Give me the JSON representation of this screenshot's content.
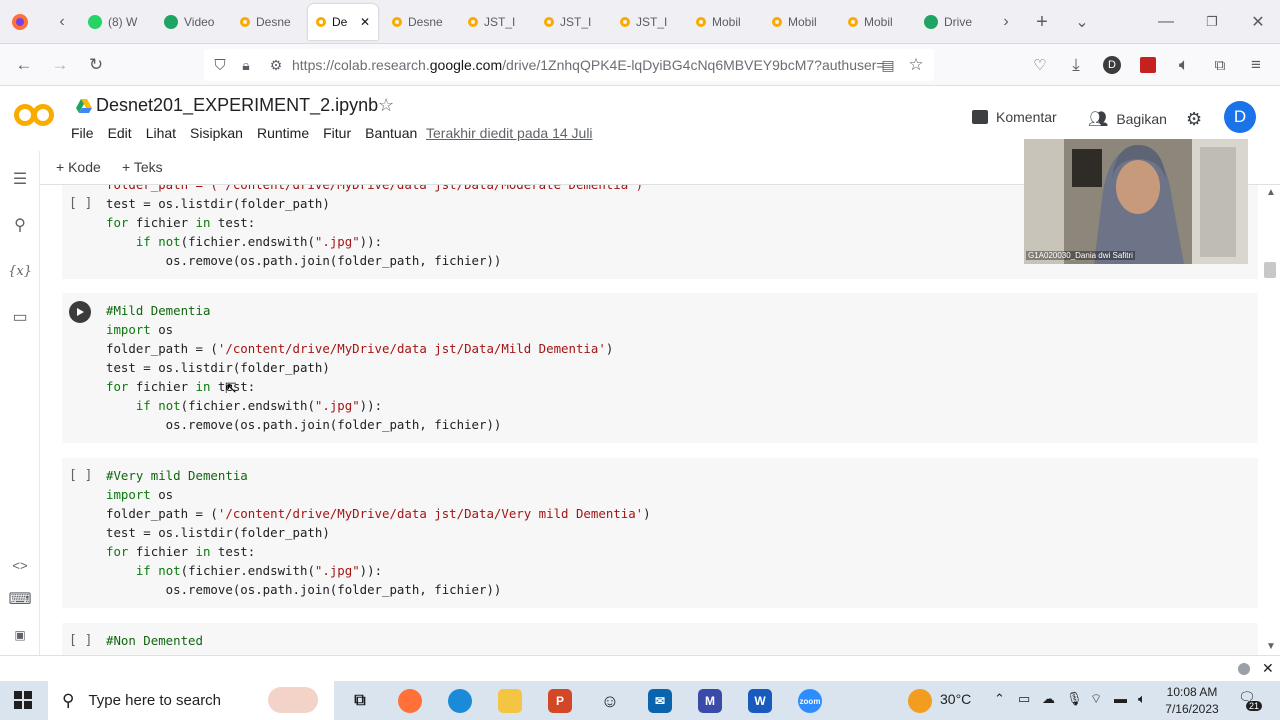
{
  "browser": {
    "tabs": [
      {
        "label": "(8) W",
        "favicon": "whatsapp-icon",
        "color": "#25d366"
      },
      {
        "label": "Video",
        "favicon": "drive-icon",
        "color": "#1fa463"
      },
      {
        "label": "Desne",
        "favicon": "colab-icon",
        "color": "#f9ab00"
      },
      {
        "label": "De",
        "favicon": "colab-icon",
        "color": "#f9ab00",
        "active": true
      },
      {
        "label": "Desne",
        "favicon": "colab-icon",
        "color": "#f9ab00"
      },
      {
        "label": "JST_I",
        "favicon": "colab-icon",
        "color": "#f9ab00"
      },
      {
        "label": "JST_I",
        "favicon": "colab-icon",
        "color": "#f9ab00"
      },
      {
        "label": "JST_I",
        "favicon": "colab-icon",
        "color": "#f9ab00"
      },
      {
        "label": "Mobil",
        "favicon": "colab-icon",
        "color": "#f9ab00"
      },
      {
        "label": "Mobil",
        "favicon": "colab-icon",
        "color": "#f9ab00"
      },
      {
        "label": "Mobil",
        "favicon": "colab-icon",
        "color": "#f9ab00"
      },
      {
        "label": "Drive",
        "favicon": "drive-icon",
        "color": "#1fa463"
      }
    ],
    "url_prefix": "https://colab.research.",
    "url_domain": "google.com",
    "url_rest": "/drive/1ZnhqQPK4E-lqDyiBG4cNq6MBVEY9bcM7?authuser="
  },
  "colab": {
    "notebook_title": "Desnet201_EXPERIMENT_2.ipynb",
    "menu": [
      "File",
      "Edit",
      "Lihat",
      "Sisipkan",
      "Runtime",
      "Fitur",
      "Bantuan"
    ],
    "last_edited": "Terakhir diedit pada 14 Juli",
    "comment_label": "Komentar",
    "share_label": "Bagikan",
    "avatar_letter": "D",
    "add_code_label": "Kode",
    "add_text_label": "Teks"
  },
  "cells": {
    "c0": {
      "bracket": "[ ]",
      "l0": "folder_path = ('/content/drive/MyDrive/data jst/Data/Moderate Dementia')",
      "l1a": "test = os.listdir(folder_path)",
      "l2a": "for",
      "l2b": " fichier ",
      "l2c": "in",
      "l2d": " test:",
      "l3a": "    ",
      "l3b": "if",
      "l3c": " ",
      "l3d": "not",
      "l3e": "(fichier.endswith(",
      "l3f": "\".jpg\"",
      "l3g": ")):",
      "l4": "        os.remove(os.path.join(folder_path, fichier))"
    },
    "c1": {
      "comment": "#Mild Dementia",
      "l1a": "import",
      "l1b": " os",
      "l2a": "folder_path = (",
      "l2b": "'/content/drive/MyDrive/data jst/Data/Mild Dementia'",
      "l2c": ")",
      "l3": "test = os.listdir(folder_path)",
      "l4a": "for",
      "l4b": " fichier ",
      "l4c": "in",
      "l4d": " test:",
      "l5a": "    ",
      "l5b": "if",
      "l5c": " ",
      "l5d": "not",
      "l5e": "(fichier.endswith(",
      "l5f": "\".jpg\"",
      "l5g": ")):",
      "l6": "        os.remove(os.path.join(folder_path, fichier))"
    },
    "c2": {
      "bracket": "[ ]",
      "comment": "#Very mild Dementia",
      "l1a": "import",
      "l1b": " os",
      "l2a": "folder_path = (",
      "l2b": "'/content/drive/MyDrive/data jst/Data/Very mild Dementia'",
      "l2c": ")",
      "l3": "test = os.listdir(folder_path)",
      "l4a": "for",
      "l4b": " fichier ",
      "l4c": "in",
      "l4d": " test:",
      "l5a": "    ",
      "l5b": "if",
      "l5c": " ",
      "l5d": "not",
      "l5e": "(fichier.endswith(",
      "l5f": "\".jpg\"",
      "l5g": ")):",
      "l6": "        os.remove(os.path.join(folder_path, fichier))"
    },
    "c3": {
      "bracket": "[ ]",
      "comment": "#Non Demented"
    }
  },
  "video_overlay": {
    "participant_name": "G1A020030_Dania dwi Safitri"
  },
  "taskbar": {
    "search_placeholder": "Type here to search",
    "temperature": "30°C",
    "time": "10:08 AM",
    "date": "7/16/2023",
    "notification_count": "21"
  }
}
